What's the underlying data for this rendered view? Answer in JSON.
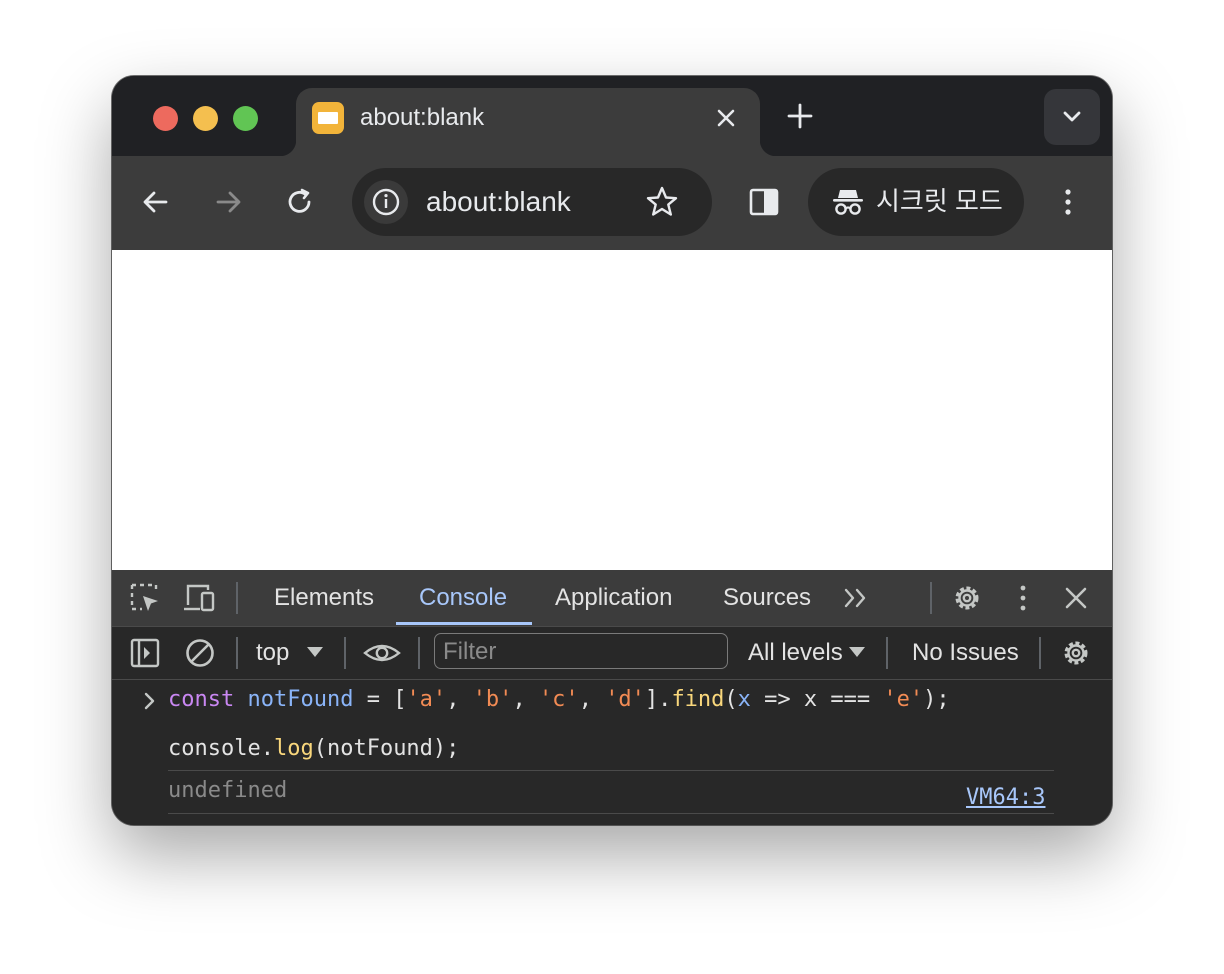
{
  "tab": {
    "title": "about:blank"
  },
  "toolbar": {
    "url": "about:blank",
    "incognito_label": "시크릿 모드"
  },
  "devtools": {
    "tabs": [
      "Elements",
      "Console",
      "Application",
      "Sources"
    ],
    "active_tab": "Console",
    "context": "top",
    "filter_placeholder": "Filter",
    "levels": "All levels",
    "issues": "No Issues"
  },
  "console": {
    "input_line_1": {
      "kw": "const",
      "var": "notFound",
      "op": " = [",
      "s1": "'a'",
      "c1": ", ",
      "s2": "'b'",
      "c2": ", ",
      "s3": "'c'",
      "c3": ", ",
      "s4": "'d'",
      "close": "].",
      "fn": "find",
      "open": "(",
      "param": "x",
      "arrow": " => x === ",
      "s5": "'e'",
      "end": ");"
    },
    "input_line_2": {
      "obj": "console.",
      "fn": "log",
      "args": "(notFound);"
    },
    "output": "undefined",
    "source_link": "VM64:3"
  },
  "colors": {
    "accent": "#a8c7fa",
    "frame": "#202124",
    "toolbar": "#3c3c3c",
    "keyword": "#c987f2",
    "string": "#f28b54",
    "function": "#f9d77c"
  }
}
